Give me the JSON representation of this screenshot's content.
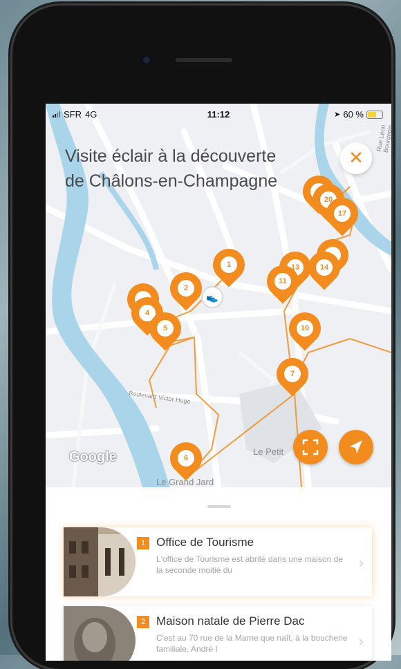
{
  "status_bar": {
    "carrier": "SFR",
    "network": "4G",
    "time": "11:12",
    "battery": "60 %"
  },
  "map": {
    "title_line1": "Visite éclair à la découverte",
    "title_line2": "de Châlons-en-Champagne",
    "close_symbol": "✕",
    "attribution": "Google",
    "streets": [
      "Boulevard Victor Hugo",
      "Le Petit",
      "Le Grand Jard",
      "Rue Léon Bourgeois"
    ],
    "pins": [
      "1",
      "2",
      "4",
      "5",
      "6",
      "7",
      "10",
      "11",
      "13",
      "14",
      "17",
      "20"
    ],
    "accent_color": "#f28c1f",
    "river_color": "#a9d4ea"
  },
  "list": {
    "items": [
      {
        "number": "1",
        "title": "Office de Tourisme",
        "description": "L'office de Tourisme est abrité dans une maison de la seconde moitié du"
      },
      {
        "number": "2",
        "title": "Maison natale de Pierre Dac",
        "description": "C'est au 70 rue de la Marne que naît, à la boucherie familiale, André I"
      }
    ]
  }
}
